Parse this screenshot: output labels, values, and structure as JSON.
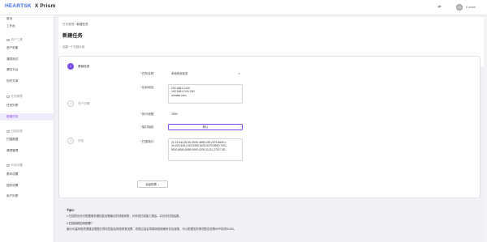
{
  "app": {
    "logo": "HEARTSK",
    "product": "X Prism"
  },
  "topbar": {
    "lang_icon": "translate-icon",
    "user_name": "X prism"
  },
  "sidebar": {
    "items_top": [
      {
        "label": "首页"
      },
      {
        "label": "工作台"
      }
    ],
    "group1": "资产工具",
    "group1_items": [
      {
        "label": "资产收集"
      },
      {
        "label": "漏洞测试"
      },
      {
        "label": "漏扫平台"
      },
      {
        "label": "知识文库"
      }
    ],
    "group2": "任务管理",
    "group2_items": [
      {
        "label": "任务列表"
      },
      {
        "label": "新建任务"
      }
    ],
    "group3": "扫描结果",
    "group3_items": [
      {
        "label": "扫描数据"
      },
      {
        "label": "漏洞管理"
      }
    ],
    "group4": "系统设置",
    "group4_items": [
      {
        "label": "基本设置"
      },
      {
        "label": "插件设置"
      },
      {
        "label": "用户列表"
      }
    ]
  },
  "breadcrumb": {
    "parent": "任务管理",
    "sep": "/",
    "current": "新建任务"
  },
  "page": {
    "title": "新建任务",
    "subtitle": "创建一个扫描计划"
  },
  "steps": [
    {
      "num": "1",
      "label": "基础信息"
    },
    {
      "num": "2",
      "label": "资产设置"
    },
    {
      "num": "3",
      "label": "完成"
    }
  ],
  "form": {
    "name_label": "任务名称:",
    "name_value": "本地安全检查",
    "target_label": "目标地址:",
    "target_lines": [
      "192.168.0.1/24",
      "192.168.4.100-200",
      "domain.com"
    ],
    "exec_label": "执行线程:",
    "exec_value": "2500",
    "fp_label": "端口指纹:",
    "fp_value": "默认",
    "ports_label": "扫描端口:",
    "ports_lines": [
      "21,22,444,80,81,5040,4898,135,2375,4630,1",
      "39,443,445,1433,3306,5432,6379,8500,7001,",
      "8000,8080,8089,9000,9200,11211,27017,82..."
    ],
    "adv_button": "高级配置 ⌄"
  },
  "tips": {
    "title": "Tips:",
    "line1": "1.扫描的优化可根据服务器性能设置最优的线程参数，对系统扫描能力提高，并优化扫描结果。",
    "q": "2.扫描线程如何配置?",
    "line2": "面对大量网络资源建议根据计算机性能及网络带宽设置，线程过高会导致网络拥堵丢包及误报，可以根据实际情况配合设置ARP探测VLAN。"
  }
}
